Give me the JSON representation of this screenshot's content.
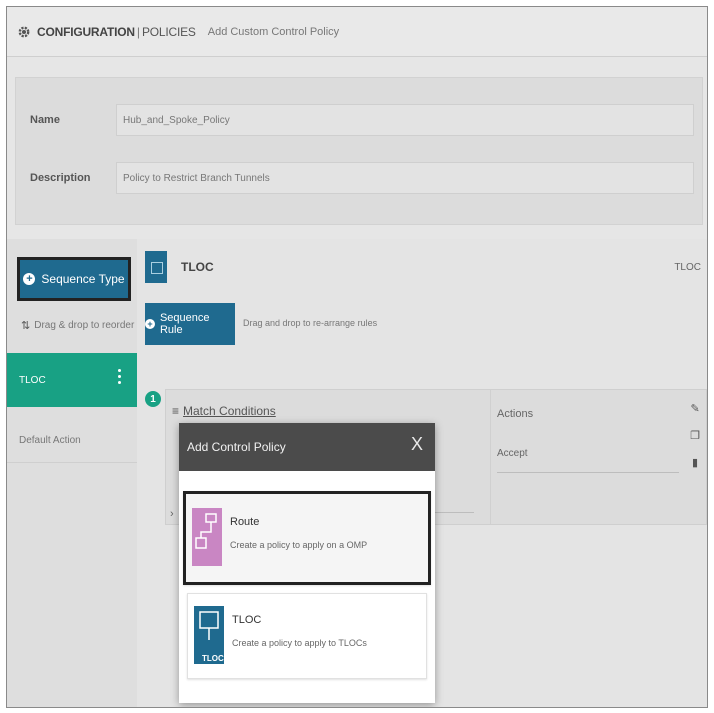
{
  "header": {
    "crumb1": "CONFIGURATION",
    "separator": "|",
    "crumb2": "POLICIES",
    "crumb3": "Add Custom Control Policy"
  },
  "form": {
    "name_label": "Name",
    "name_value": "Hub_and_Spoke_Policy",
    "description_label": "Description",
    "description_value": "Policy to Restrict Branch Tunnels"
  },
  "sidebar": {
    "sequence_type_label": "Sequence Type",
    "drag_hint": "Drag & drop to reorder",
    "items": [
      {
        "label": "TLOC"
      },
      {
        "label": "Default Action"
      }
    ]
  },
  "main": {
    "title": "TLOC",
    "title_right": "TLOC",
    "sequence_rule_label": "Sequence Rule",
    "rule_hint": "Drag and drop to re-arrange rules",
    "rule_number": "1",
    "match_conditions_label": "Match Conditions",
    "actions_label": "Actions",
    "accept_label": "Accept"
  },
  "modal": {
    "title": "Add Control Policy",
    "close_label": "X",
    "options": [
      {
        "name": "Route",
        "description": "Create a policy to apply on a OMP"
      },
      {
        "name": "TLOC",
        "description": "Create a policy to apply to TLOCs",
        "icon_label": "TLOC"
      }
    ]
  },
  "colors": {
    "primary_blue": "#1f6a8f",
    "teal": "#18a184",
    "route_pink": "#c986c3",
    "modal_header": "#4b4b4b"
  }
}
